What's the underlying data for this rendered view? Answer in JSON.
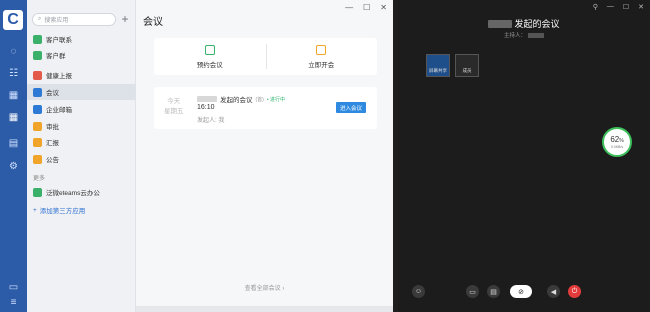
{
  "sidebar": {
    "search_placeholder": "搜索应用",
    "plus": "+",
    "items": [
      {
        "label": "客户联系",
        "color": "#3ab06a"
      },
      {
        "label": "客户群",
        "color": "#3ab06a"
      },
      {
        "label": "健康上报",
        "color": "#e45a4a"
      },
      {
        "label": "会议",
        "color": "#2c7ad6"
      },
      {
        "label": "企业邮箱",
        "color": "#2c7ad6"
      },
      {
        "label": "审批",
        "color": "#f0a52a"
      },
      {
        "label": "汇报",
        "color": "#f0a52a"
      },
      {
        "label": "公告",
        "color": "#f0a52a"
      }
    ],
    "section_more": "更多",
    "extra_item": {
      "label": "泛微eteams云办公",
      "color": "#3ab06a"
    },
    "add_third_party": "添加第三方应用"
  },
  "content": {
    "page_title": "会议",
    "actions": [
      {
        "label": "预约会议",
        "color": "#3ab06a"
      },
      {
        "label": "立即开会",
        "color": "#f0a52a"
      }
    ],
    "meeting": {
      "day": "今天",
      "weekday": "星期五",
      "title_suffix": "发起的会议",
      "tag": "(首)",
      "status": "• 进行中",
      "time": "16:10",
      "host": "发起人: 我",
      "join_label": "进入会议"
    },
    "view_all": "查看全部会议 ›"
  },
  "meeting_view": {
    "title_suffix": "发起的会议",
    "host_prefix": "主持人：",
    "thumbs": [
      {
        "label": "屏幕共享"
      },
      {
        "label": "成员"
      }
    ],
    "gauge": {
      "value": "62",
      "unit": "%",
      "sub": "0.0KB/s"
    }
  }
}
